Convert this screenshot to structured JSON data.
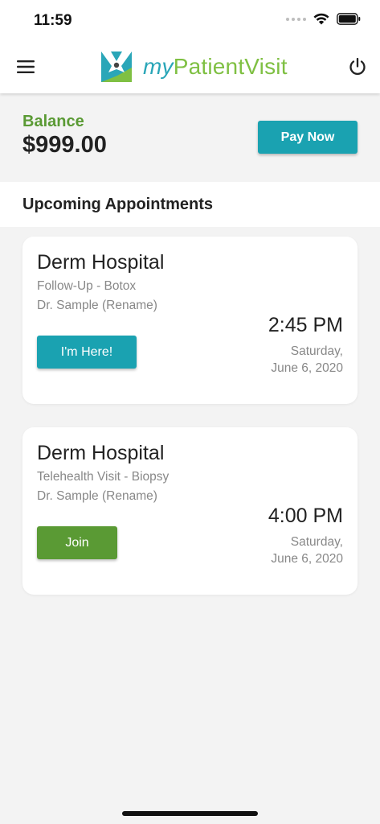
{
  "status_bar": {
    "time": "11:59",
    "icons": [
      "signal-icon",
      "wifi-icon",
      "battery-icon"
    ]
  },
  "header": {
    "logo_prefix": "my",
    "logo_rest": "PatientVisit",
    "menu_icon": "hamburger-menu-icon",
    "power_icon": "power-icon"
  },
  "colors": {
    "teal": "#1aa2b1",
    "green": "#5a9a34",
    "logo_green": "#7fc043",
    "logo_teal": "#2aa6b8"
  },
  "balance": {
    "label": "Balance",
    "amount": "$999.00",
    "pay_button": "Pay Now"
  },
  "upcoming": {
    "title": "Upcoming Appointments",
    "appointments": [
      {
        "facility": "Derm Hospital",
        "visit_type": "Follow-Up - Botox",
        "doctor": "Dr. Sample (Rename)",
        "time": "2:45 PM",
        "day": "Saturday,",
        "date": "June 6, 2020",
        "button": "I'm Here!"
      },
      {
        "facility": "Derm Hospital",
        "visit_type": "Telehealth Visit - Biopsy",
        "doctor": "Dr. Sample (Rename)",
        "time": "4:00 PM",
        "day": "Saturday,",
        "date": "June 6, 2020",
        "button": "Join"
      }
    ]
  }
}
